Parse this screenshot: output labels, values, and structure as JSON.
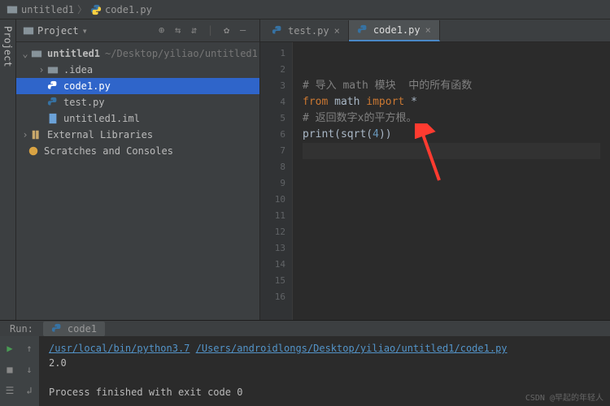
{
  "breadcrumb": {
    "project": "untitled1",
    "file": "code1.py"
  },
  "sidebar": {
    "label": "Project"
  },
  "panel": {
    "title": "Project"
  },
  "tree": {
    "root": "untitled1",
    "root_path": "~/Desktop/yiliao/untitled1",
    "items": [
      {
        "name": ".idea",
        "depth": 1,
        "arrow": "›"
      },
      {
        "name": "code1.py",
        "depth": 1,
        "selected": true
      },
      {
        "name": "test.py",
        "depth": 1
      },
      {
        "name": "untitled1.iml",
        "depth": 1
      }
    ],
    "ext_libs": "External Libraries",
    "scratches": "Scratches and Consoles"
  },
  "tabs": [
    {
      "label": "test.py",
      "active": false
    },
    {
      "label": "code1.py",
      "active": true
    }
  ],
  "gutter": [
    "1",
    "2",
    "3",
    "4",
    "5",
    "6",
    "7",
    "8",
    "9",
    "10",
    "11",
    "12",
    "13",
    "14",
    "15",
    "16"
  ],
  "code": {
    "l3": "# 导入 math 模块  中的所有函数",
    "l4a": "from",
    "l4b": "math",
    "l4c": "import",
    "l4d": "*",
    "l5": "# 返回数字x的平方根。",
    "l6a": "print",
    "l6b": "(sqrt(",
    "l6c": "4",
    "l6d": "))"
  },
  "run": {
    "label": "Run:",
    "tab": "code1",
    "path1": "/usr/local/bin/python3.7",
    "path2": "/Users/androidlongs/Desktop/yiliao/untitled1/code1.py",
    "output": "2.0",
    "finished": "Process finished with exit code 0"
  },
  "watermark": "CSDN @早起的年轻人"
}
